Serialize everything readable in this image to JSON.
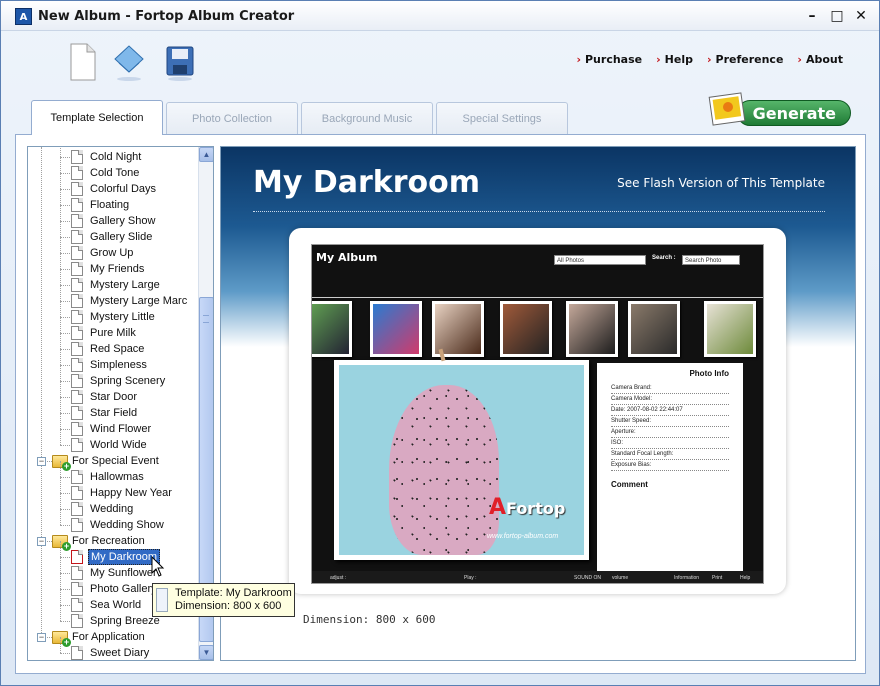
{
  "window": {
    "title": "New Album - Fortop Album Creator",
    "app_icon_text": "A",
    "controls": [
      "–",
      "□",
      "✕"
    ]
  },
  "toolbar": {
    "icons": [
      "new-file-icon",
      "open-icon",
      "save-icon"
    ],
    "links": [
      "Purchase",
      "Help",
      "Preference",
      "About"
    ]
  },
  "tabs": [
    "Template Selection",
    "Photo Collection",
    "Background Music",
    "Special Settings"
  ],
  "generate_label": "Generate",
  "tree": {
    "rows": [
      {
        "label": "Cold Night",
        "type": "item"
      },
      {
        "label": "Cold Tone",
        "type": "item"
      },
      {
        "label": "Colorful Days",
        "type": "item"
      },
      {
        "label": "Floating",
        "type": "item"
      },
      {
        "label": "Gallery Show",
        "type": "item"
      },
      {
        "label": "Gallery Slide",
        "type": "item"
      },
      {
        "label": "Grow Up",
        "type": "item"
      },
      {
        "label": "My Friends",
        "type": "item"
      },
      {
        "label": "Mystery Large",
        "type": "item"
      },
      {
        "label": "Mystery Large Marc",
        "type": "item"
      },
      {
        "label": "Mystery Little",
        "type": "item"
      },
      {
        "label": "Pure Milk",
        "type": "item"
      },
      {
        "label": "Red Space",
        "type": "item"
      },
      {
        "label": "Simpleness",
        "type": "item"
      },
      {
        "label": "Spring Scenery",
        "type": "item"
      },
      {
        "label": "Star Door",
        "type": "item"
      },
      {
        "label": "Star Field",
        "type": "item"
      },
      {
        "label": "Wind Flower",
        "type": "item"
      },
      {
        "label": "World Wide",
        "type": "item"
      },
      {
        "label": "For Special Event",
        "type": "folder"
      },
      {
        "label": "Hallowmas",
        "type": "item"
      },
      {
        "label": "Happy New Year",
        "type": "item"
      },
      {
        "label": "Wedding",
        "type": "item"
      },
      {
        "label": "Wedding Show",
        "type": "item"
      },
      {
        "label": "For Recreation",
        "type": "folder"
      },
      {
        "label": "My Darkroom",
        "type": "item",
        "selected": true
      },
      {
        "label": "My Sunflower",
        "type": "item"
      },
      {
        "label": "Photo Gallery",
        "type": "item"
      },
      {
        "label": "Sea World",
        "type": "item"
      },
      {
        "label": "Spring Breeze",
        "type": "item"
      },
      {
        "label": "For Application",
        "type": "folder"
      },
      {
        "label": "Sweet Diary",
        "type": "item"
      }
    ],
    "expander_symbol": "−"
  },
  "tooltip": {
    "line1": "Template: My Darkroom",
    "line2": "Dimension: 800 x 600"
  },
  "preview": {
    "title": "My Darkroom",
    "flash_link": "See Flash Version of This Template",
    "dimension": "Dimension: 800 x 600",
    "album": {
      "title": "My Album",
      "dropdown": "All Photos",
      "search_label": "Search :",
      "search_placeholder": "Search Photo",
      "info_title": "Photo Info",
      "info_rows": [
        "Camera Brand:",
        "Camera Model:",
        "Date: 2007-08-02 22:44:07",
        "Shutter Speed:",
        "Aperture:",
        "ISO:",
        "Standard Focal Length:",
        "Exposure Bias:"
      ],
      "comment": "Comment",
      "logo_letter": "A",
      "logo_text": "Fortop",
      "url": "www.fortop-album.com",
      "controls": [
        "adjust :",
        "Play :",
        "SOUND ON",
        "volume",
        "Information",
        "Print",
        "Help"
      ]
    }
  },
  "colors": {
    "accent": "#316ac5",
    "generate": "#1f7b35",
    "header_dark": "#0b3564"
  }
}
